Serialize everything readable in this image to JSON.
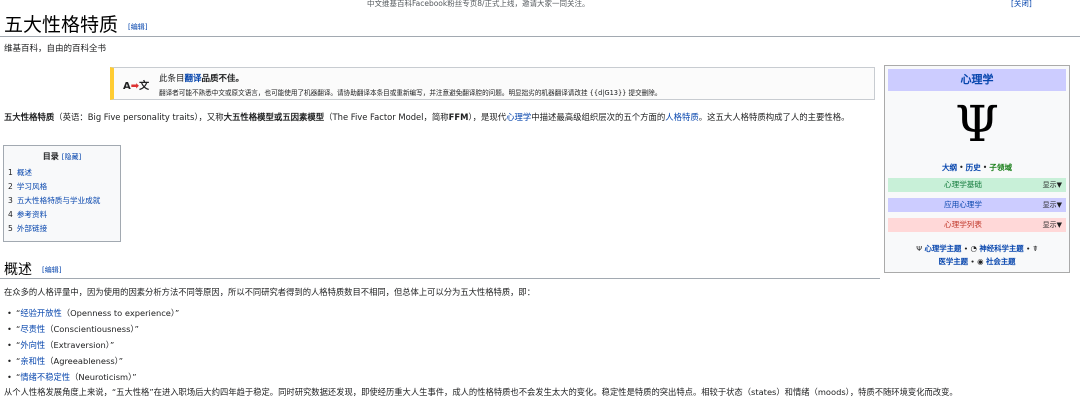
{
  "banner": {
    "message": "中文维基百科Facebook粉丝专页8/正式上线，邀请大家一同关注。",
    "close": "[关闭]"
  },
  "page": {
    "title": "五大性格特质",
    "title_edit": "[编辑]",
    "tagline": "维基百科，自由的百科全书"
  },
  "ambox": {
    "icon": "translate-icon",
    "icon_a": "A",
    "icon_arrow": "➡",
    "icon_zh": "文",
    "line1_pre": "此条目",
    "line1_link": "翻译",
    "line1_post": "品质不佳。",
    "line2": "翻译者可能不熟悉中文或原文语言，也可能使用了机器翻译。请协助翻译本条目或重新编写，并注意避免翻译腔的问题。明显拙劣的机器翻译请改挂 {{d|G13}} 提交删除。"
  },
  "lead": {
    "term": "五大性格特质",
    "part1": "（英语：Big Five personality traits），又称",
    "bold1": "大五性格模型或五因素模型",
    "part2": "（The Five Factor Model，简称",
    "bold2": "FFM",
    "part3": "），是现代",
    "link1": "心理学",
    "part4": "中描述最高级组织层次的五个方面的",
    "link2": "人格特质",
    "part5": "。这五大人格特质构成了人的主要性格。"
  },
  "toc": {
    "title": "目录",
    "hide": "[隐藏]",
    "items": [
      {
        "num": "1",
        "text": "概述"
      },
      {
        "num": "2",
        "text": "学习风格"
      },
      {
        "num": "3",
        "text": "五大性格特质与学业成就"
      },
      {
        "num": "4",
        "text": "参考资料"
      },
      {
        "num": "5",
        "text": "外部链接"
      }
    ]
  },
  "overview": {
    "heading": "概述",
    "edit": "[编辑]",
    "para1": "在众多的人格评量中，因为使用的因素分析方法不同等原因，所以不同研究者得到的人格特质数目不相同，但总体上可以分为五大性格特质，即：",
    "traits": [
      {
        "open": "“",
        "link": "经验开放性",
        "rest": "（Openness to experience）”"
      },
      {
        "open": "“",
        "link": "尽责性",
        "rest": "（Conscientiousness）”"
      },
      {
        "open": "“",
        "link": "外向性",
        "rest": "（Extraversion）”"
      },
      {
        "open": "“",
        "link": "亲和性",
        "rest": "（Agreeableness）”"
      },
      {
        "open": "“",
        "link": "情绪不稳定性",
        "rest": "（Neuroticism）”"
      }
    ],
    "para2": "从个人性格发展角度上来说，“五大性格”在进入职场后大约四年趋于稳定。同时研究数据还发现，即使经历重大人生事件，成人的性格特质也不会发生太大的变化。稳定性是特质的突出特点。相较于状态（states）和情绪（moods），特质不随环境变化而改变。"
  },
  "sidebar": {
    "title": "心理学",
    "symbol": "Ψ",
    "links": [
      "大纲",
      "历史",
      "子领域"
    ],
    "dot": "•",
    "rows": [
      {
        "label": "心理学基础",
        "toggle": "显示▼"
      },
      {
        "label": "应用心理学",
        "toggle": "显示▼"
      },
      {
        "label": "心理学列表",
        "toggle": "显示▼"
      }
    ],
    "portals": [
      {
        "icon": "Ψ",
        "label": "心理学主题"
      },
      {
        "icon": "◔",
        "label": "神经科学主题"
      },
      {
        "icon": "☤",
        "label": "医学主题"
      },
      {
        "icon": "◉",
        "label": "社会主题"
      }
    ]
  }
}
